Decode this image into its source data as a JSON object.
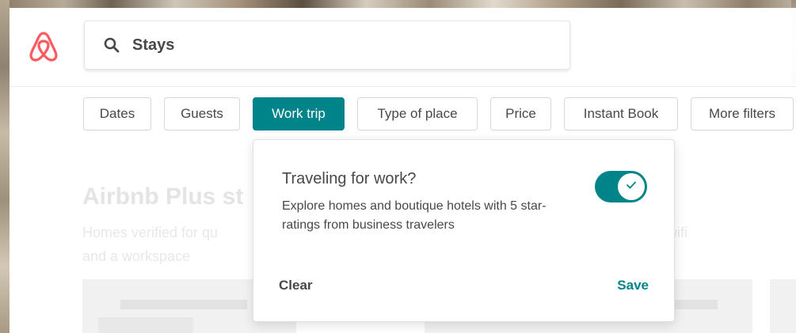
{
  "search": {
    "value": "Stays"
  },
  "filters": [
    {
      "label": "Dates",
      "active": false
    },
    {
      "label": "Guests",
      "active": false
    },
    {
      "label": "Work trip",
      "active": true
    },
    {
      "label": "Type of place",
      "active": false
    },
    {
      "label": "Price",
      "active": false
    },
    {
      "label": "Instant Book",
      "active": false
    },
    {
      "label": "More filters",
      "active": false
    }
  ],
  "background": {
    "section_title": "Airbnb Plus st",
    "section_sub_line1_left": "Homes verified for qu",
    "section_sub_line1_right": "wifi",
    "section_sub_line2": "and a workspace"
  },
  "popover": {
    "title": "Traveling for work?",
    "description": "Explore homes and boutique hotels with 5 star-ratings from business travelers",
    "toggle_on": true,
    "clear_label": "Clear",
    "save_label": "Save"
  },
  "colors": {
    "brand": "#ff5a5f",
    "accent": "#00848a",
    "text": "#484848"
  },
  "icons": {
    "logo": "airbnb-logo",
    "search": "search-icon",
    "check": "check-icon"
  }
}
